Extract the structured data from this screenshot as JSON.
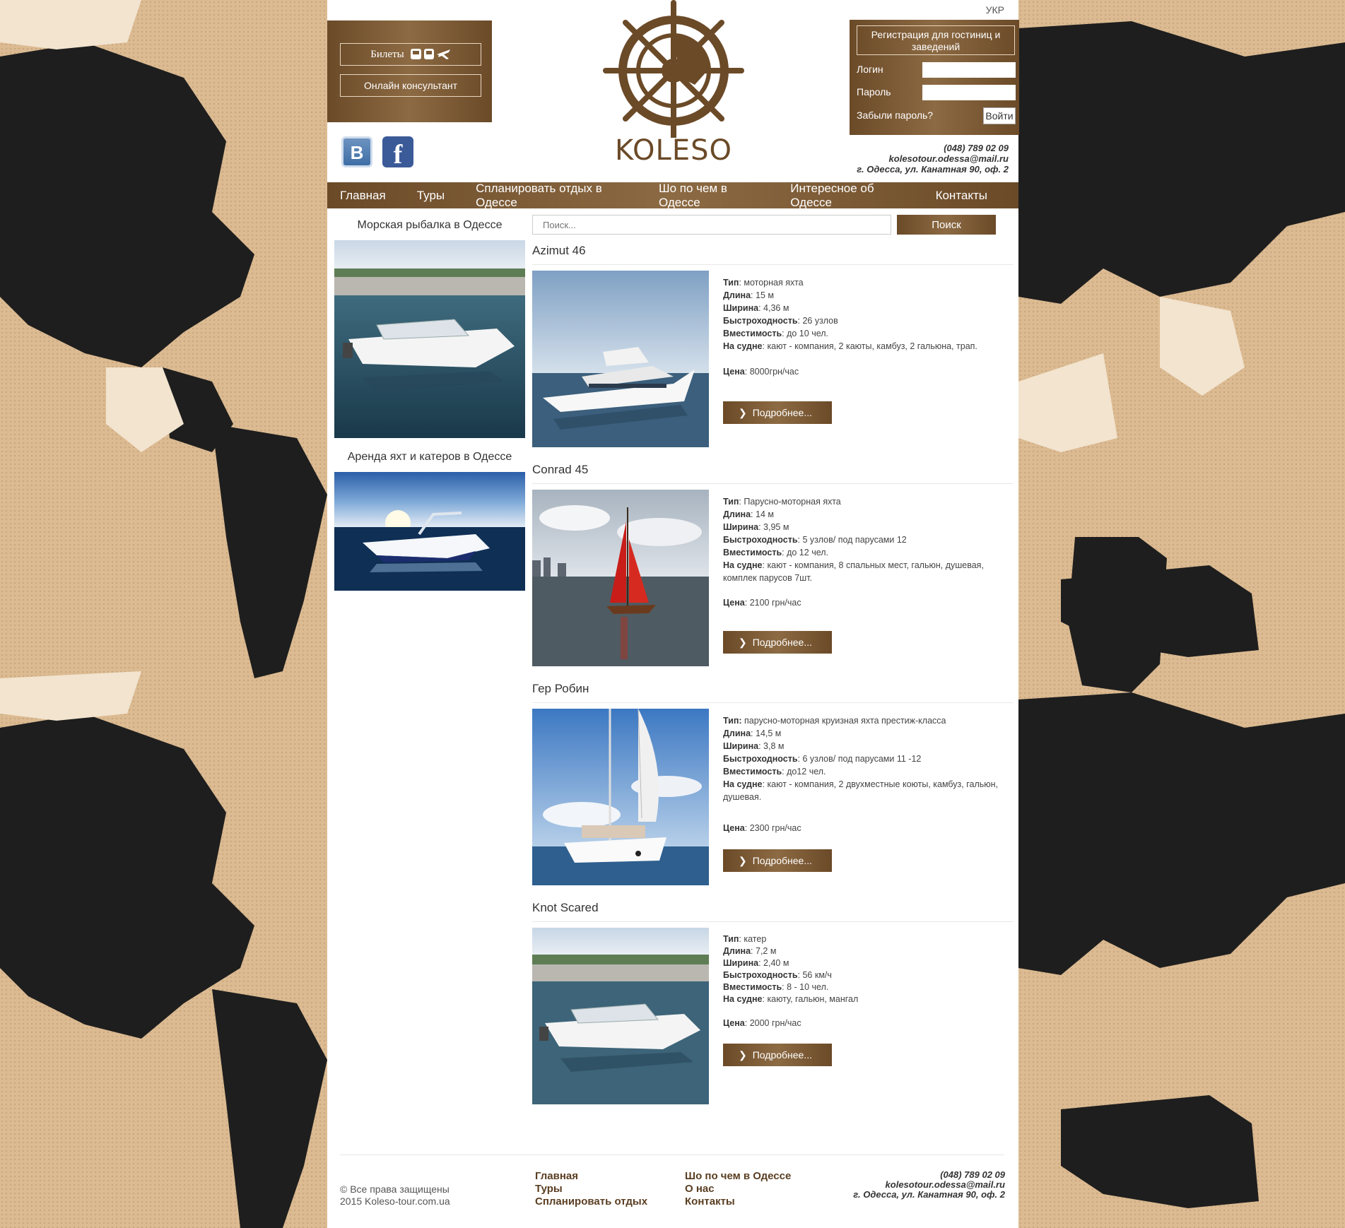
{
  "header": {
    "lang": "УКР",
    "tickets_label": "Билеты",
    "consultant_label": "Онлайн консультант",
    "logo_text": "KOLESO",
    "vk_icon": "В",
    "fb_icon": "f",
    "register_label": "Регистрация для гостиниц и заведений",
    "login_label": "Логин",
    "password_label": "Пароль",
    "forgot_label": "Забыли пароль?",
    "login_button": "Войти",
    "phone": "(048) 789 02 09",
    "email": "kolesotour.odessa@mail.ru",
    "address": "г. Одесса, ул. Канатная 90, оф. 2"
  },
  "nav": [
    "Главная",
    "Туры",
    "Спланировать отдых в Одессе",
    "Шо по чем в Одессе",
    "Интересное об Одессе",
    "Контакты"
  ],
  "sidebar": {
    "block1_title": "Морская рыбалка в Одессе",
    "block2_title": "Аренда яхт и катеров в Одессе"
  },
  "search": {
    "placeholder": "Поиск...",
    "button": "Поиск"
  },
  "items": [
    {
      "title": "Azimut 46",
      "specs": [
        {
          "label": "Тип",
          "value": "моторная яхта"
        },
        {
          "label": "Длина",
          "value": "  15 м"
        },
        {
          "label": "Ширина",
          "value": " 4,36 м"
        },
        {
          "label": "Быстроходность",
          "value": " 26 узлов"
        },
        {
          "label": "Вместимость",
          "value": " до 10 чел."
        },
        {
          "label": "На судне",
          "value": "  кают - компания, 2 каюты, камбуз, 2 гальюна, трап."
        }
      ],
      "price_label": "Цена",
      "price": "8000грн/час",
      "more": "Подробнее..."
    },
    {
      "title": "Conrad 45",
      "specs": [
        {
          "label": "Тип",
          "value": " Парусно-моторная яхта"
        },
        {
          "label": "Длина",
          "value": " 14 м"
        },
        {
          "label": "Ширина",
          "value": " 3,95 м"
        },
        {
          "label": "Быстроходность",
          "value": " 5 узлов/ под парусами 12"
        },
        {
          "label": "Вместимость",
          "value": " до 12 чел."
        },
        {
          "label": "На судне",
          "value": " кают - компания, 8 спальных мест, гальюн, душевая, комплек парусов 7шт."
        }
      ],
      "price_label": "Цена",
      "price": " 2100 грн/час",
      "more": "Подробнее..."
    },
    {
      "title": "Гер Робин",
      "specs": [
        {
          "label": "Тип:",
          "value": " парусно-моторная круизная яхта престиж-класса"
        },
        {
          "label": "Длина",
          "value": " 14,5 м"
        },
        {
          "label": "Ширина",
          "value": " 3,8 м"
        },
        {
          "label": "Быстроходность",
          "value": " 6 узлов/ под парусами 11 -12"
        },
        {
          "label": "Вместимость",
          "value": " до12 чел."
        },
        {
          "label": "На судне",
          "value": " кают - компания, 2 двухместные коюты, камбуз, гальюн, душевая."
        }
      ],
      "price_label": "Цена",
      "price": " 2300 грн/час",
      "more": "Подробнее..."
    },
    {
      "title": "Knot Scared",
      "specs": [
        {
          "label": "Тип",
          "value": " катер"
        },
        {
          "label": "Длина",
          "value": " 7,2 м"
        },
        {
          "label": "Ширина",
          "value": " 2,40 м"
        },
        {
          "label": "Быстроходность",
          "value": " 56 км/ч"
        },
        {
          "label": "Вместимость",
          "value": " 8 - 10 чел."
        },
        {
          "label": "На судне",
          "value": " каюту, гальюн, мангал"
        }
      ],
      "price_label": "Цена",
      "price": " 2000 грн/час",
      "more": "Подробнее..."
    }
  ],
  "footer": {
    "copyright": "© Все права защищены",
    "site": "2015 Koleso-tour.com.ua",
    "col1": [
      "Главная",
      "Туры",
      "Спланировать отдых"
    ],
    "col2": [
      "Шо по чем в Одессе",
      "О нас",
      "Контакты"
    ],
    "phone": "(048) 789 02 09",
    "email": "kolesotour.odessa@mail.ru",
    "address": "г. Одесса, ул. Канатная 90, оф. 2"
  },
  "colors": {
    "brown": "#6b4a28",
    "brown_light": "#8c6a43",
    "background": "#dcbb92"
  }
}
